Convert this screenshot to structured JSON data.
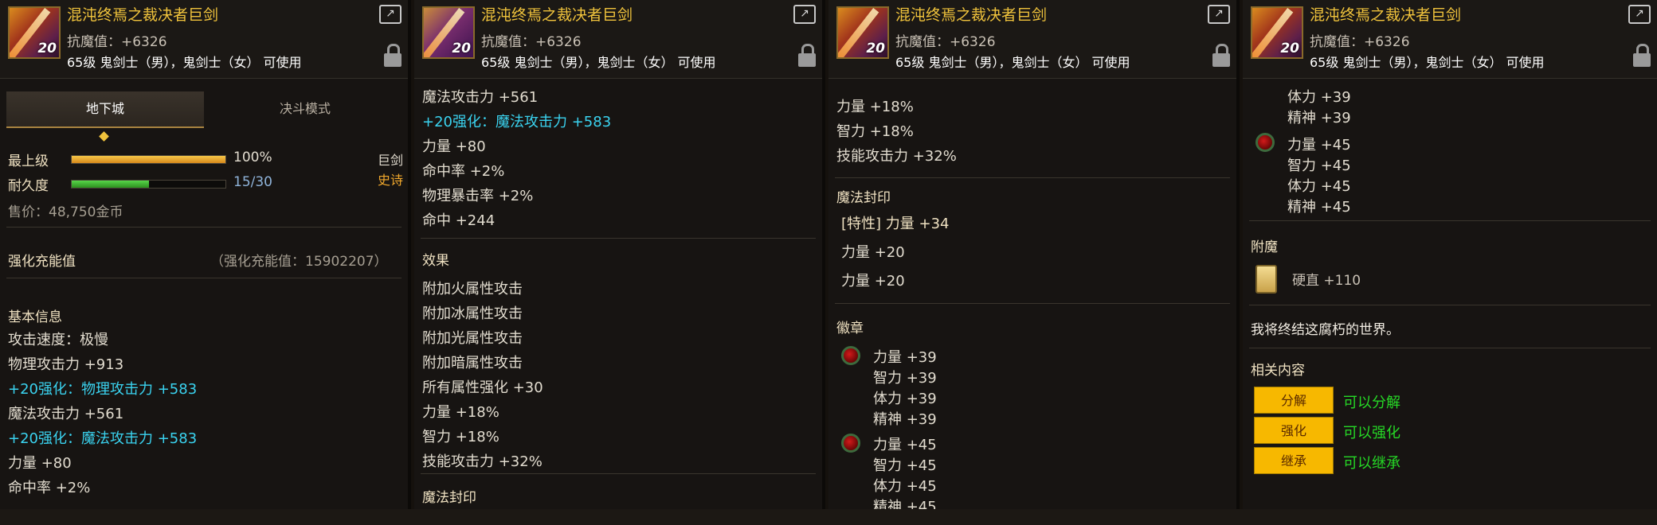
{
  "item": {
    "name": "混沌终焉之裁决者巨剑",
    "resist": "抗魔值：+6326",
    "requirement": "65级 鬼剑士（男），鬼剑士（女） 可使用",
    "enhance_level": "20"
  },
  "panel1": {
    "tab_dungeon": "地下城",
    "tab_pvp": "决斗模式",
    "grade_label": "最上级",
    "grade_value": "100%",
    "durability_label": "耐久度",
    "durability_value": "15/30",
    "durability_fraction": 0.5,
    "weapon_type": "巨剑",
    "rarity": "史诗",
    "price": "售价：48,750金币",
    "charge_label": "强化充能值",
    "charge_value": "（强化充能值：15902207）",
    "basic_info": "基本信息",
    "lines": [
      {
        "text": "攻击速度：极慢",
        "cls": ""
      },
      {
        "text": "物理攻击力 +913",
        "cls": ""
      },
      {
        "text": "+20强化：物理攻击力 +583",
        "cls": "cyan"
      },
      {
        "text": "魔法攻击力 +561",
        "cls": ""
      },
      {
        "text": "+20强化：魔法攻击力 +583",
        "cls": "cyan"
      },
      {
        "text": "力量 +80",
        "cls": ""
      },
      {
        "text": "命中率 +2%",
        "cls": ""
      }
    ]
  },
  "panel2": {
    "lines_top": [
      {
        "text": "魔法攻击力 +561",
        "cls": ""
      },
      {
        "text": "+20强化：魔法攻击力 +583",
        "cls": "cyan"
      },
      {
        "text": "力量 +80",
        "cls": ""
      },
      {
        "text": "命中率 +2%",
        "cls": ""
      },
      {
        "text": "物理暴击率 +2%",
        "cls": ""
      },
      {
        "text": "命中 +244",
        "cls": ""
      }
    ],
    "effects_label": "效果",
    "effects": [
      "附加火属性攻击",
      "附加冰属性攻击",
      "附加光属性攻击",
      "附加暗属性攻击",
      "所有属性强化 +30",
      "力量 +18%",
      "智力 +18%",
      "技能攻击力 +32%"
    ],
    "seal_label": "魔法封印"
  },
  "panel3": {
    "lines_top": [
      "力量 +18%",
      "智力 +18%",
      "技能攻击力 +32%"
    ],
    "seal_label": "魔法封印",
    "seal_lines": [
      "[特性] 力量 +34",
      "力量 +20",
      "力量 +20"
    ],
    "emblem_label": "徽章",
    "emblem1": [
      "力量 +39",
      "智力 +39",
      "体力 +39",
      "精神 +39"
    ],
    "emblem2": [
      "力量 +45",
      "智力 +45",
      "体力 +45",
      "精神 +45"
    ]
  },
  "panel4": {
    "emblem_prev": [
      "体力 +39",
      "精神 +39"
    ],
    "emblem2": [
      "力量 +45",
      "智力 +45",
      "体力 +45",
      "精神 +45"
    ],
    "enchant_label": "附魔",
    "enchant_value": "硬直 +110",
    "flavor": "我将终结这腐朽的世界。",
    "related_label": "相关内容",
    "actions": [
      {
        "btn": "分解",
        "note": "可以分解"
      },
      {
        "btn": "强化",
        "note": "可以强化"
      },
      {
        "btn": "继承",
        "note": "可以继承"
      }
    ]
  }
}
